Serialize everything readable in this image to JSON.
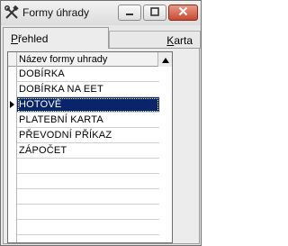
{
  "window": {
    "title": "Formy úhrady"
  },
  "tabs": [
    {
      "label_underlined": "P",
      "label_rest": "řehled"
    },
    {
      "label_underlined": "K",
      "label_rest": "arta"
    }
  ],
  "grid": {
    "column_header": "Název formy uhrady",
    "selected_index": 2,
    "rows": [
      "DOBÍRKA",
      "DOBÍRKA NA EET",
      "HOTOVĚ",
      "PLATEBNÍ KARTA",
      "PŘEVODNÍ PŘÍKAZ",
      "ZÁPOČET"
    ],
    "empty_rows": 5
  },
  "colors": {
    "selection": "#0a246a",
    "close_button": "#c94a30"
  },
  "icons": {
    "app": "tools-icon",
    "minimize": "minimize-icon",
    "maximize": "maximize-icon",
    "close": "close-icon",
    "scroll_up": "scroll-up-arrow-icon",
    "row_indicator": "current-row-arrow-icon"
  }
}
